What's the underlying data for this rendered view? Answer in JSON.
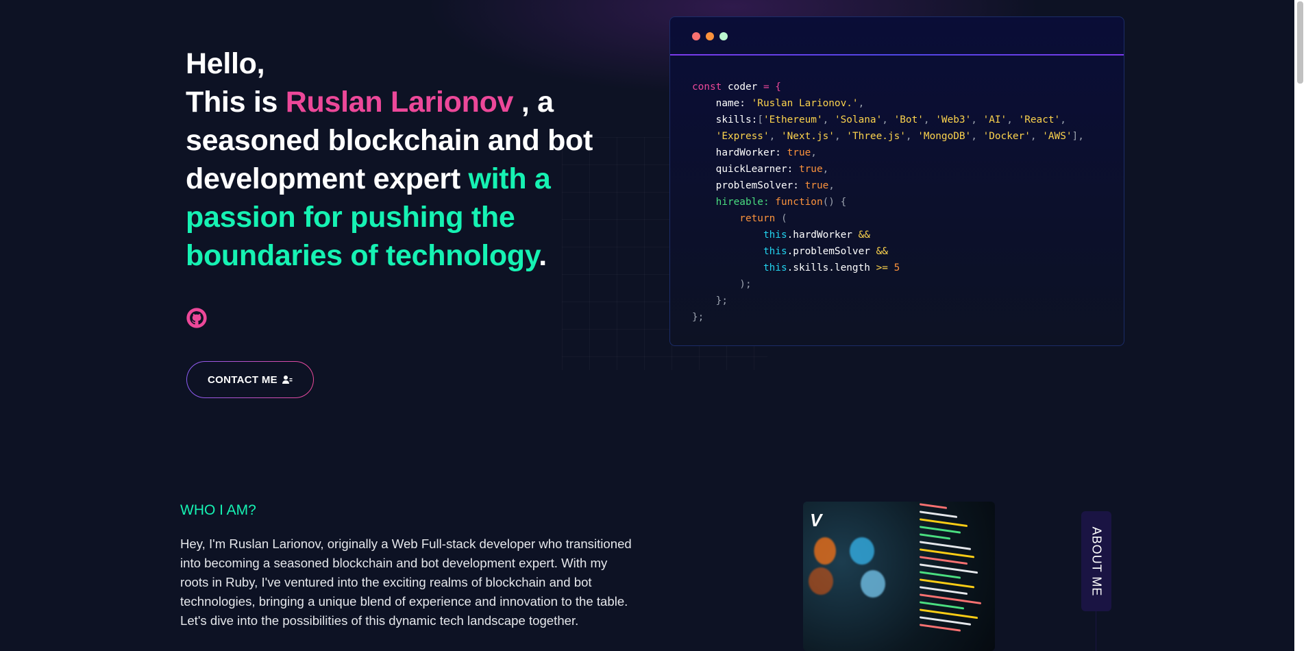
{
  "hero": {
    "greeting": "Hello,",
    "intro_prefix": "This is",
    "name": "Ruslan Larionov",
    "intro_suffix": ", a seasoned blockchain and bot development expert",
    "highlight": "with a passion for pushing the boundaries of technology",
    "period": ".",
    "social": {
      "icon": "github-icon"
    },
    "contact_button": {
      "label": "CONTACT ME",
      "icon": "user-icon"
    }
  },
  "code_window": {
    "lines": {
      "l1_const": "const",
      "l1_var": " coder ",
      "l1_eq": "= {",
      "name_key": "    name: ",
      "name_val": "'Ruslan Larionov.'",
      "skills_key": "    skills:",
      "skills_line1": [
        "'Ethereum'",
        "'Solana'",
        "'Bot'",
        "'Web3'",
        "'AI'",
        "'React'"
      ],
      "skills_line2": [
        "'Express'",
        "'Next.js'",
        "'Three.js'",
        "'MongoDB'",
        "'Docker'",
        "'AWS'"
      ],
      "hardworker_key": "    hardWorker: ",
      "quicklearner_key": "    quickLearner: ",
      "problemsolver_key": "    problemSolver: ",
      "true_val": "true",
      "hireable_key": "    hireable: ",
      "function_kw": "function",
      "function_rest": "() {",
      "return_kw": "        return",
      "return_paren": " (",
      "this_kw": "this",
      "and_op": "&&",
      "ge_op": ">=",
      "five": "5",
      "hardworker_prop": ".hardWorker ",
      "problemsolver_prop": ".problemSolver ",
      "skills_length_prop": ".skills.length ",
      "close_paren": "        );",
      "close_fn": "    };",
      "close_obj": "};"
    }
  },
  "about": {
    "heading": "WHO I AM?",
    "paragraph": "Hey, I'm Ruslan Larionov, originally a Web Full-stack developer who transitioned into becoming a seasoned blockchain and bot development expert. With my roots in Ruby, I've ventured into the exciting realms of blockchain and bot technologies, bringing a unique blend of experience and innovation to the table. Let's dive into the possibilities of this dynamic tech landscape together.",
    "side_tab": "ABOUT ME"
  },
  "colors": {
    "background": "#0d1224",
    "accent_pink": "#ec4899",
    "accent_green": "#16f2b3",
    "accent_violet": "#8b5cf6"
  }
}
